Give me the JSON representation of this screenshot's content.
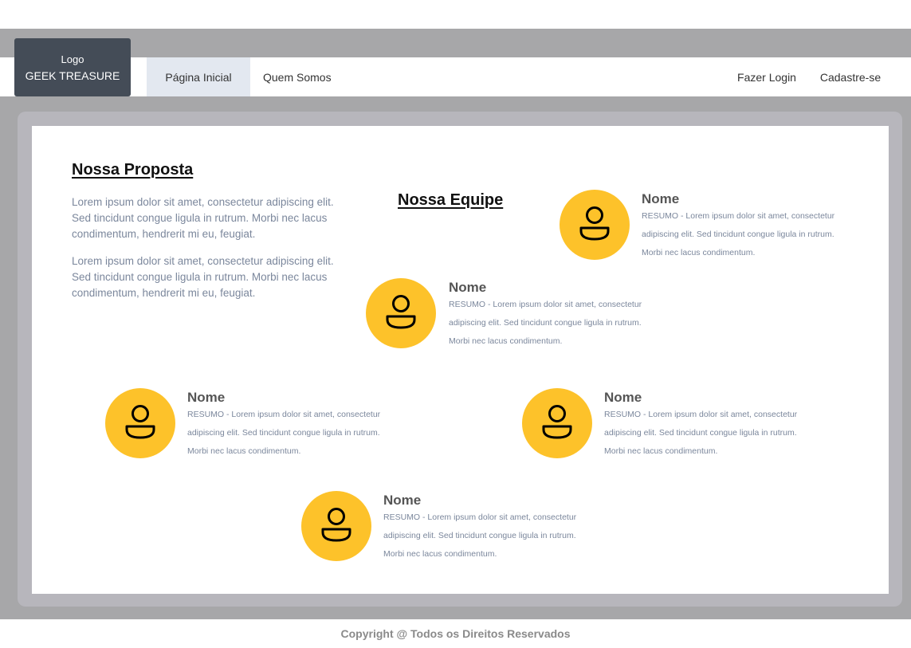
{
  "header": {
    "logo_line1": "Logo",
    "logo_line2": "GEEK TREASURE",
    "nav": {
      "home": "Página Inicial",
      "about": "Quem Somos",
      "login": "Fazer Login",
      "signup": "Cadastre-se"
    }
  },
  "proposal": {
    "title": "Nossa Proposta",
    "paragraphs": [
      "Lorem ipsum dolor sit amet, consectetur adipiscing elit. Sed tincidunt congue ligula in rutrum. Morbi nec lacus condimentum, hendrerit mi eu, feugiat.",
      "Lorem ipsum dolor sit amet, consectetur adipiscing elit. Sed tincidunt congue ligula in rutrum. Morbi nec lacus condimentum, hendrerit mi eu, feugiat."
    ]
  },
  "team": {
    "title": "Nossa Equipe",
    "members": [
      {
        "name": "Nome",
        "summary": "RESUMO - Lorem ipsum dolor sit amet, consectetur adipiscing elit. Sed tincidunt congue ligula in rutrum. Morbi nec lacus condimentum."
      },
      {
        "name": "Nome",
        "summary": "RESUMO - Lorem ipsum dolor sit amet, consectetur adipiscing elit. Sed tincidunt congue ligula in rutrum. Morbi nec lacus condimentum."
      },
      {
        "name": "Nome",
        "summary": "RESUMO - Lorem ipsum dolor sit amet, consectetur adipiscing elit. Sed tincidunt congue ligula in rutrum. Morbi nec lacus condimentum."
      },
      {
        "name": "Nome",
        "summary": "RESUMO - Lorem ipsum dolor sit amet, consectetur adipiscing elit. Sed tincidunt congue ligula in rutrum. Morbi nec lacus condimentum."
      },
      {
        "name": "Nome",
        "summary": "RESUMO - Lorem ipsum dolor sit amet, consectetur adipiscing elit. Sed tincidunt congue ligula in rutrum. Morbi nec lacus condimentum."
      }
    ],
    "avatar_icon": "user-icon",
    "avatar_color": "#fdc22a"
  },
  "footer": {
    "copyright": "Copyright @ Todos os Direitos Reservados"
  },
  "colors": {
    "logo_bg": "#444c57",
    "active_tab_bg": "#e3e8f0",
    "frame_gray": "#a7a7a9",
    "body_text": "#7b879c"
  }
}
